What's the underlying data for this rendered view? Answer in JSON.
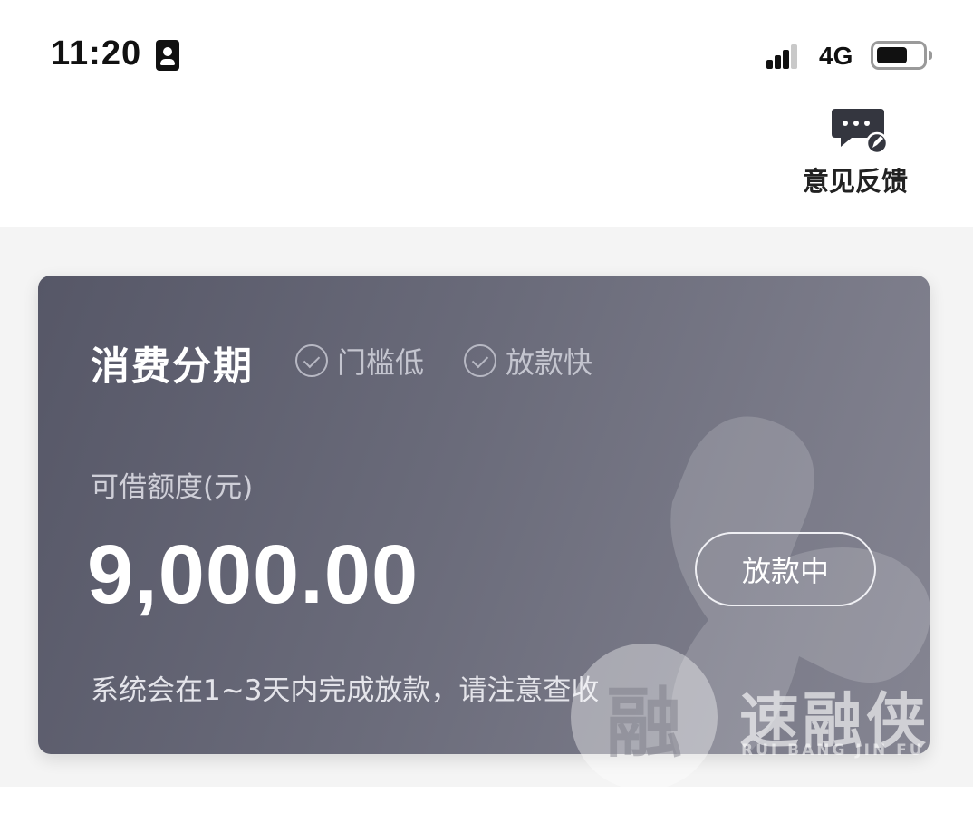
{
  "status_bar": {
    "time": "11:20",
    "network": "4G",
    "icons": [
      "id-card-icon",
      "signal-icon",
      "battery-icon"
    ]
  },
  "header": {
    "feedback_label": "意见反馈",
    "feedback_icon": "feedback-chat-icon"
  },
  "card": {
    "title": "消费分期",
    "tags": [
      "门槛低",
      "放款快"
    ],
    "quota_label": "可借额度(元)",
    "amount": "9,000.00",
    "status_button": "放款中",
    "notice": "系统会在1~3天内完成放款，请注意查收",
    "colors": {
      "gradient_start": "#565767",
      "gradient_end": "#858592"
    }
  },
  "watermark": {
    "glyph": "融",
    "name": "速融侠",
    "sub": "RUI BANG JIN FU"
  }
}
